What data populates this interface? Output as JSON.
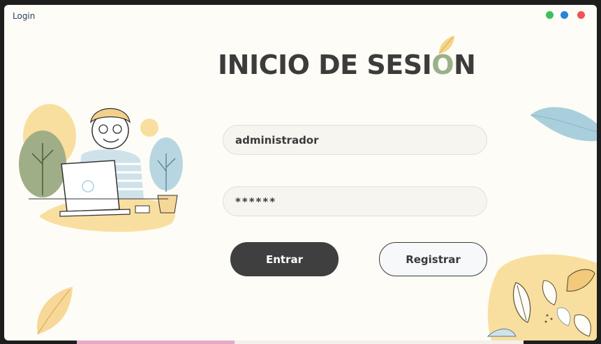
{
  "window": {
    "title": "Login",
    "controls": [
      {
        "name": "green-dot",
        "color": "#3cc05a"
      },
      {
        "name": "blue-dot",
        "color": "#2a84d8"
      },
      {
        "name": "red-dot",
        "color": "#f05454"
      }
    ]
  },
  "heading": {
    "part1": "INICIO DE SESI",
    "part2": "O",
    "part3": "N"
  },
  "form": {
    "username_value": "administrador",
    "password_value": "******"
  },
  "buttons": {
    "enter_label": "Entrar",
    "register_label": "Registrar"
  },
  "colors": {
    "accent_dark": "#3f3f3f",
    "accent_green": "#9bb08a",
    "leaf_yellow": "#f7d898",
    "leaf_blue": "#a9cfdc"
  }
}
